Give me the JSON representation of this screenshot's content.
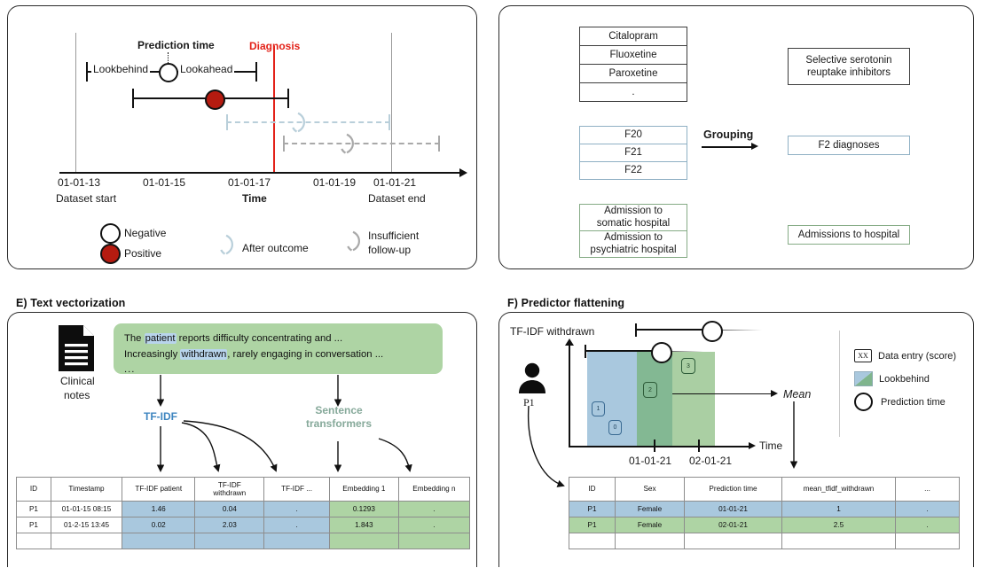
{
  "figure": {
    "panels": [
      {
        "id": "A",
        "title": ""
      },
      {
        "id": "B",
        "title": ""
      },
      {
        "id": "E",
        "title": "E) Text vectorization"
      },
      {
        "id": "F",
        "title": "F) Predictor flattening"
      }
    ]
  },
  "panelA": {
    "labels": {
      "prediction_time": "Prediction time",
      "diagnosis": "Diagnosis",
      "lookbehind": "Lookbehind",
      "lookahead": "Lookahead",
      "axis_title": "Time",
      "dataset_start": "Dataset start",
      "dataset_end": "Dataset end"
    },
    "ticks": [
      "01-01-13",
      "01-01-15",
      "01-01-17",
      "01-01-19",
      "01-01-21"
    ],
    "legend": [
      {
        "key": "negative",
        "label": "Negative",
        "marker": "open-circle"
      },
      {
        "key": "positive",
        "label": "Positive",
        "marker": "filled-circle"
      },
      {
        "key": "after_outcome",
        "label": "After outcome",
        "marker": "broken-arc-blue"
      },
      {
        "key": "insufficient",
        "label": "Insufficient follow-up",
        "marker": "broken-arc-gray"
      }
    ],
    "colors": {
      "diagnosis": "#e32219",
      "positive": "#b51b10",
      "after_outcome": "#b9cfda",
      "insufficient": "#a9a9a9"
    }
  },
  "panelB": {
    "operation": "Grouping",
    "groups": [
      {
        "style": "dark",
        "sources": [
          "Citalopram",
          "Fluoxetine",
          "Paroxetine",
          "."
        ],
        "target": "Selective serotonin\nreuptake inhibitors",
        "target_line1": "Selective serotonin",
        "target_line2": "reuptake inhibitors"
      },
      {
        "style": "blue",
        "sources": [
          "F20",
          "F21",
          "F22"
        ],
        "target_line1": "F2 diagnoses",
        "target_line2": ""
      },
      {
        "style": "green",
        "sources": [
          "Admission to somatic hospital",
          "Admission to psychiatric hospital"
        ],
        "source_lines": [
          [
            "Admission to",
            "somatic hospital"
          ],
          [
            "Admission to",
            "psychiatric hospital"
          ]
        ],
        "target_line1": "Admissions to hospital",
        "target_line2": ""
      }
    ],
    "colors": {
      "dark": "#3d3d3d",
      "blue": "#8fb0c4",
      "green": "#86ab86"
    }
  },
  "panelE": {
    "title": "E) Text vectorization",
    "source_icon_label_line1": "Clinical",
    "source_icon_label_line2": "notes",
    "note": {
      "line1_pre": "The ",
      "line1_hl": "patient",
      "line1_post": " reports difficulty concentrating and ...",
      "line2_pre": "Increasingly ",
      "line2_hl": "withdrawn",
      "line2_post": ", rarely engaging in conversation ...",
      "line3": "..."
    },
    "methods": [
      {
        "key": "tfidf",
        "label_line1": "TF-IDF",
        "label_line2": "",
        "color": "#3f86c0"
      },
      {
        "key": "sentence_transformers",
        "label_line1": "Sentence",
        "label_line2": "transformers",
        "color": "#86a99a"
      }
    ],
    "table": {
      "headers": [
        "ID",
        "Timestamp",
        "TF-IDF patient",
        "TF-IDF withdrawn",
        "TF-IDF ...",
        "Embedding 1",
        "Embedding n"
      ],
      "header_lines": [
        [
          "ID"
        ],
        [
          "Timestamp"
        ],
        [
          "TF-IDF patient"
        ],
        [
          "TF-IDF",
          "withdrawn"
        ],
        [
          "TF-IDF ..."
        ],
        [
          "Embedding 1"
        ],
        [
          "Embedding n"
        ]
      ],
      "rows": [
        [
          "P1",
          "01-01-15 08:15",
          "1.46",
          "0.04",
          ".",
          "0.1293",
          "."
        ],
        [
          "P1",
          "01-2-15 13:45",
          "0.02",
          "2.03",
          ".",
          "1.843",
          "."
        ]
      ],
      "tint": [
        "none",
        "none",
        "blue",
        "blue",
        "blue",
        "green",
        "green"
      ]
    }
  },
  "panelF": {
    "title": "F) Predictor flattening",
    "y_axis_label": "TF-IDF withdrawn",
    "x_axis_label": "Time",
    "patient_label": "P1",
    "aggregation_label": "Mean",
    "x_ticks": [
      "01-01-21",
      "02-01-21"
    ],
    "data_entries": [
      {
        "score": "1",
        "tint": "blue"
      },
      {
        "score": "0",
        "tint": "blue"
      },
      {
        "score": "2",
        "tint": "green"
      },
      {
        "score": "3",
        "tint": "green"
      }
    ],
    "legend": [
      {
        "key": "data_entry",
        "label": "Data entry (score)",
        "marker": "xx-box",
        "marker_text": "XX"
      },
      {
        "key": "lookbehind",
        "label": "Lookbehind",
        "marker": "split-swatch"
      },
      {
        "key": "prediction_time",
        "label": "Prediction time",
        "marker": "open-circle"
      }
    ],
    "table": {
      "headers": [
        "ID",
        "Sex",
        "Prediction time",
        "mean_tfidf_withdrawn",
        "..."
      ],
      "rows": [
        [
          "P1",
          "Female",
          "01-01-21",
          "1",
          "."
        ],
        [
          "P1",
          "Female",
          "02-01-21",
          "2.5",
          "."
        ]
      ],
      "row_tint": [
        "blue",
        "green"
      ]
    },
    "colors": {
      "lookbehind_blue": "#a9c8de",
      "lookbehind_green": "#a8cfa2",
      "overlap": "#83b893"
    }
  }
}
